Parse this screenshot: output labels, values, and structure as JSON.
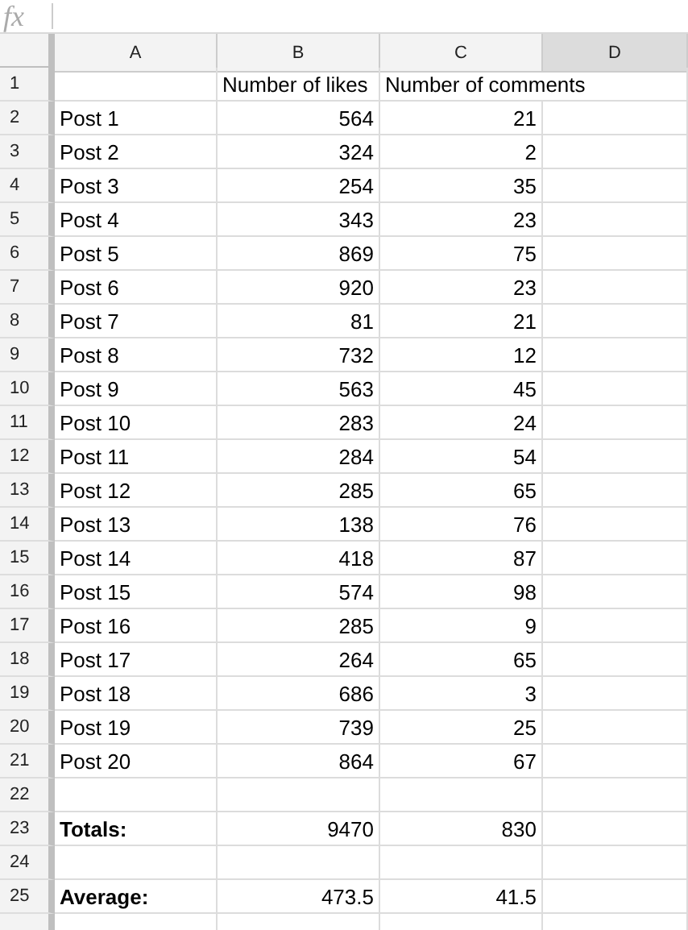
{
  "formula_bar": {
    "label": "fx"
  },
  "columns": [
    {
      "label": "A",
      "selected": false
    },
    {
      "label": "B",
      "selected": false
    },
    {
      "label": "C",
      "selected": false
    },
    {
      "label": "D",
      "selected": true
    }
  ],
  "rows": [
    {
      "number": "1",
      "kind": "heading",
      "likes": "Number of likes",
      "comments": "Number of comments"
    },
    {
      "number": "2",
      "kind": "data",
      "label": "Post 1",
      "likes": "564",
      "comments": "21"
    },
    {
      "number": "3",
      "kind": "data",
      "label": "Post 2",
      "likes": "324",
      "comments": "2"
    },
    {
      "number": "4",
      "kind": "data",
      "label": "Post 3",
      "likes": "254",
      "comments": "35"
    },
    {
      "number": "5",
      "kind": "data",
      "label": "Post 4",
      "likes": "343",
      "comments": "23"
    },
    {
      "number": "6",
      "kind": "data",
      "label": "Post 5",
      "likes": "869",
      "comments": "75"
    },
    {
      "number": "7",
      "kind": "data",
      "label": "Post 6",
      "likes": "920",
      "comments": "23"
    },
    {
      "number": "8",
      "kind": "data",
      "label": "Post 7",
      "likes": "81",
      "comments": "21"
    },
    {
      "number": "9",
      "kind": "data",
      "label": "Post 8",
      "likes": "732",
      "comments": "12"
    },
    {
      "number": "10",
      "kind": "data",
      "label": "Post 9",
      "likes": "563",
      "comments": "45"
    },
    {
      "number": "11",
      "kind": "data",
      "label": "Post 10",
      "likes": "283",
      "comments": "24"
    },
    {
      "number": "12",
      "kind": "data",
      "label": "Post 11",
      "likes": "284",
      "comments": "54"
    },
    {
      "number": "13",
      "kind": "data",
      "label": "Post 12",
      "likes": "285",
      "comments": "65"
    },
    {
      "number": "14",
      "kind": "data",
      "label": "Post 13",
      "likes": "138",
      "comments": "76"
    },
    {
      "number": "15",
      "kind": "data",
      "label": "Post 14",
      "likes": "418",
      "comments": "87"
    },
    {
      "number": "16",
      "kind": "data",
      "label": "Post 15",
      "likes": "574",
      "comments": "98"
    },
    {
      "number": "17",
      "kind": "data",
      "label": "Post 16",
      "likes": "285",
      "comments": "9"
    },
    {
      "number": "18",
      "kind": "data",
      "label": "Post 17",
      "likes": "264",
      "comments": "65"
    },
    {
      "number": "19",
      "kind": "data",
      "label": "Post 18",
      "likes": "686",
      "comments": "3"
    },
    {
      "number": "20",
      "kind": "data",
      "label": "Post 19",
      "likes": "739",
      "comments": "25"
    },
    {
      "number": "21",
      "kind": "data",
      "label": "Post 20",
      "likes": "864",
      "comments": "67"
    },
    {
      "number": "22",
      "kind": "blank"
    },
    {
      "number": "23",
      "kind": "summary",
      "label": "Totals:",
      "likes": "9470",
      "comments": "830"
    },
    {
      "number": "24",
      "kind": "blank"
    },
    {
      "number": "25",
      "kind": "summary",
      "label": "Average:",
      "likes": "473.5",
      "comments": "41.5"
    }
  ]
}
